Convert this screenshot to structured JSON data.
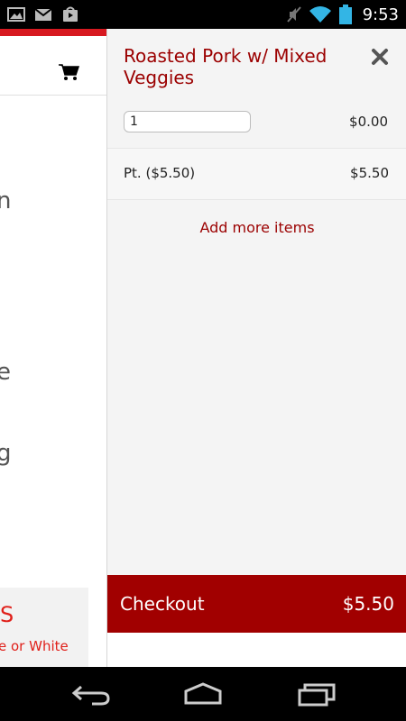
{
  "status_bar": {
    "time": "9:53",
    "left_icons": [
      "image-icon",
      "gmail-icon",
      "play-store-icon"
    ],
    "right_icons": [
      "mute-icon",
      "wifi-icon",
      "battery-icon"
    ]
  },
  "background_page": {
    "accent_color": "#d71920",
    "text_fragments": [
      "n",
      "e",
      "g"
    ],
    "promo_fragment": "S",
    "promo_subtext": "e or White"
  },
  "drawer": {
    "item_title": "Roasted Pork w/ Mixed Veggies",
    "quantity_value": "1",
    "line_price": "$0.00",
    "option": {
      "label": "Pt. ($5.50)",
      "price": "$5.50"
    },
    "add_more_label": "Add more items",
    "checkout": {
      "label": "Checkout",
      "total": "$5.50"
    },
    "colors": {
      "title": "#9b0000",
      "checkout_bg": "#a10000"
    }
  },
  "nav_bar": {
    "buttons": [
      "back-icon",
      "home-icon",
      "recent-apps-icon"
    ]
  }
}
